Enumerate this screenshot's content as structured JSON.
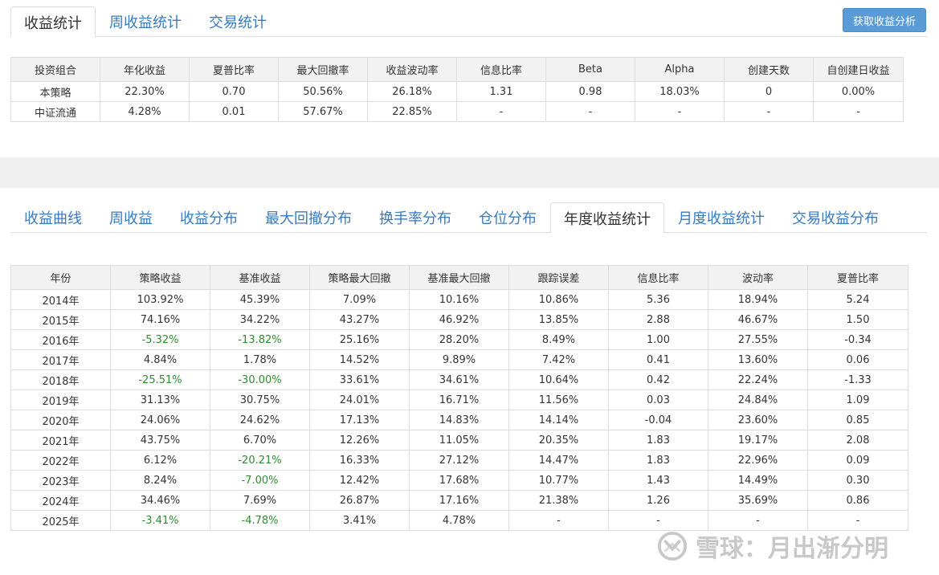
{
  "top_tabs": [
    "收益统计",
    "周收益统计",
    "交易统计"
  ],
  "top_tab_active": 0,
  "action_button": "获取收益分析",
  "stats_table": {
    "headers": [
      "投资组合",
      "年化收益",
      "夏普比率",
      "最大回撤率",
      "收益波动率",
      "信息比率",
      "Beta",
      "Alpha",
      "创建天数",
      "自创建日收益"
    ],
    "rows": [
      [
        "本策略",
        "22.30%",
        "0.70",
        "50.56%",
        "26.18%",
        "1.31",
        "0.98",
        "18.03%",
        "0",
        "0.00%"
      ],
      [
        "中证流通",
        "4.28%",
        "0.01",
        "57.67%",
        "22.85%",
        "-",
        "-",
        "-",
        "-",
        "-"
      ]
    ]
  },
  "second_tabs": [
    "收益曲线",
    "周收益",
    "收益分布",
    "最大回撤分布",
    "换手率分布",
    "仓位分布",
    "年度收益统计",
    "月度收益统计",
    "交易收益分布"
  ],
  "second_tab_active": 6,
  "yearly_table": {
    "headers": [
      "年份",
      "策略收益",
      "基准收益",
      "策略最大回撤",
      "基准最大回撤",
      "跟踪误差",
      "信息比率",
      "波动率",
      "夏普比率"
    ],
    "rows": [
      [
        "2014年",
        "103.92%",
        "45.39%",
        "7.09%",
        "10.16%",
        "10.86%",
        "5.36",
        "18.94%",
        "5.24"
      ],
      [
        "2015年",
        "74.16%",
        "34.22%",
        "43.27%",
        "46.92%",
        "13.85%",
        "2.88",
        "46.67%",
        "1.50"
      ],
      [
        "2016年",
        "-5.32%",
        "-13.82%",
        "25.16%",
        "28.20%",
        "8.49%",
        "1.00",
        "27.55%",
        "-0.34"
      ],
      [
        "2017年",
        "4.84%",
        "1.78%",
        "14.52%",
        "9.89%",
        "7.42%",
        "0.41",
        "13.60%",
        "0.06"
      ],
      [
        "2018年",
        "-25.51%",
        "-30.00%",
        "33.61%",
        "34.61%",
        "10.64%",
        "0.42",
        "22.24%",
        "-1.33"
      ],
      [
        "2019年",
        "31.13%",
        "30.75%",
        "24.01%",
        "16.71%",
        "11.56%",
        "0.03",
        "24.84%",
        "1.09"
      ],
      [
        "2020年",
        "24.06%",
        "24.62%",
        "17.13%",
        "14.83%",
        "14.14%",
        "-0.04",
        "23.60%",
        "0.85"
      ],
      [
        "2021年",
        "43.75%",
        "6.70%",
        "12.26%",
        "11.05%",
        "20.35%",
        "1.83",
        "19.17%",
        "2.08"
      ],
      [
        "2022年",
        "6.12%",
        "-20.21%",
        "16.33%",
        "27.12%",
        "14.47%",
        "1.83",
        "22.96%",
        "0.09"
      ],
      [
        "2023年",
        "8.24%",
        "-7.00%",
        "12.42%",
        "17.68%",
        "10.77%",
        "1.43",
        "14.49%",
        "0.30"
      ],
      [
        "2024年",
        "34.46%",
        "7.69%",
        "26.87%",
        "17.16%",
        "21.38%",
        "1.26",
        "35.69%",
        "0.86"
      ],
      [
        "2025年",
        "-3.41%",
        "-4.78%",
        "3.41%",
        "4.78%",
        "-",
        "-",
        "-",
        "-"
      ]
    ]
  },
  "watermark": "雪球：月出渐分明",
  "colors": {
    "link": "#3a7abf",
    "button": "#5b9bd5",
    "negative": "#2e8b2e",
    "header_bg": "#f2f2f2",
    "border": "#dddddd",
    "band": "#f0f0f0"
  }
}
